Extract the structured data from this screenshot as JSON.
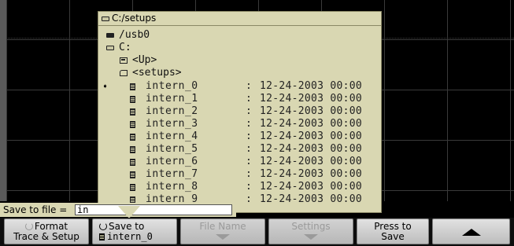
{
  "dialog": {
    "title": "C:/setups",
    "tree": [
      {
        "label": "/usb0",
        "icon": "usb-drive-icon"
      },
      {
        "label": "C:",
        "icon": "drive-icon"
      },
      {
        "label": "<Up>",
        "icon": "folder-up-icon"
      },
      {
        "label": "<setups>",
        "icon": "folder-open-icon"
      }
    ],
    "files": [
      {
        "name": "intern_0",
        "sep": ":",
        "date": "12-24-2003 00:00",
        "selected": true
      },
      {
        "name": "intern_1",
        "sep": ":",
        "date": "12-24-2003 00:00"
      },
      {
        "name": "intern_2",
        "sep": ":",
        "date": "12-24-2003 00:00"
      },
      {
        "name": "intern_3",
        "sep": ":",
        "date": "12-24-2003 00:00"
      },
      {
        "name": "intern_4",
        "sep": ":",
        "date": "12-24-2003 00:00"
      },
      {
        "name": "intern_5",
        "sep": ":",
        "date": "12-24-2003 00:00"
      },
      {
        "name": "intern_6",
        "sep": ":",
        "date": "12-24-2003 00:00"
      },
      {
        "name": "intern_7",
        "sep": ":",
        "date": "12-24-2003 00:00"
      },
      {
        "name": "intern_8",
        "sep": ":",
        "date": "12-24-2003 00:00"
      },
      {
        "name": "intern_9",
        "sep": ":",
        "date": "12-24-2003 00:00"
      }
    ]
  },
  "save_to": {
    "label": "Save to file =",
    "value": "in"
  },
  "softkeys": {
    "format_line1": "Format",
    "format_line2": "Trace & Setup",
    "save_to_line1": "Save to",
    "save_to_line2": "intern_0",
    "file_name": "File Name",
    "settings": "Settings",
    "press_line1": "Press to",
    "press_line2": "Save"
  },
  "colors": {
    "dialog_bg": "#d9d7b2",
    "screen_bg": "#000000",
    "softkey_bg": "#d4d4d4"
  }
}
